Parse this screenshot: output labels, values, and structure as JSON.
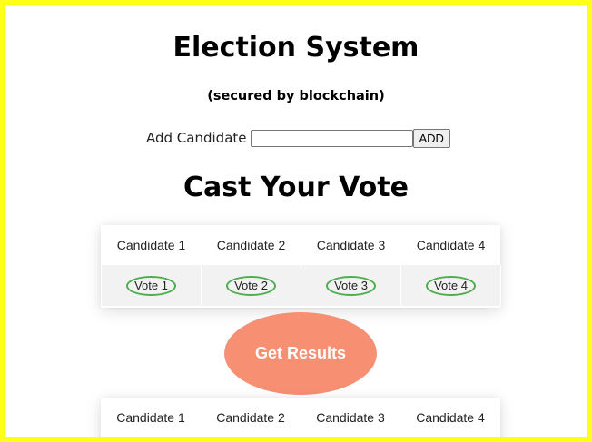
{
  "header": {
    "title": "Election System",
    "subtitle": "(secured by blockchain)"
  },
  "add_candidate": {
    "label": "Add Candidate",
    "input_value": "",
    "button_label": "ADD"
  },
  "vote_section": {
    "title": "Cast Your Vote",
    "candidates": [
      "Candidate 1",
      "Candidate 2",
      "Candidate 3",
      "Candidate 4"
    ],
    "vote_buttons": [
      "Vote 1",
      "Vote 2",
      "Vote 3",
      "Vote 4"
    ]
  },
  "results": {
    "button_label": "Get Results",
    "candidates": [
      "Candidate 1",
      "Candidate 2",
      "Candidate 3",
      "Candidate 4"
    ]
  },
  "colors": {
    "page_border": "#ffff1a",
    "results_button": "#f78f72",
    "vote_button_border": "#4cae4c",
    "vote_row_background": "#f2f2f2"
  }
}
